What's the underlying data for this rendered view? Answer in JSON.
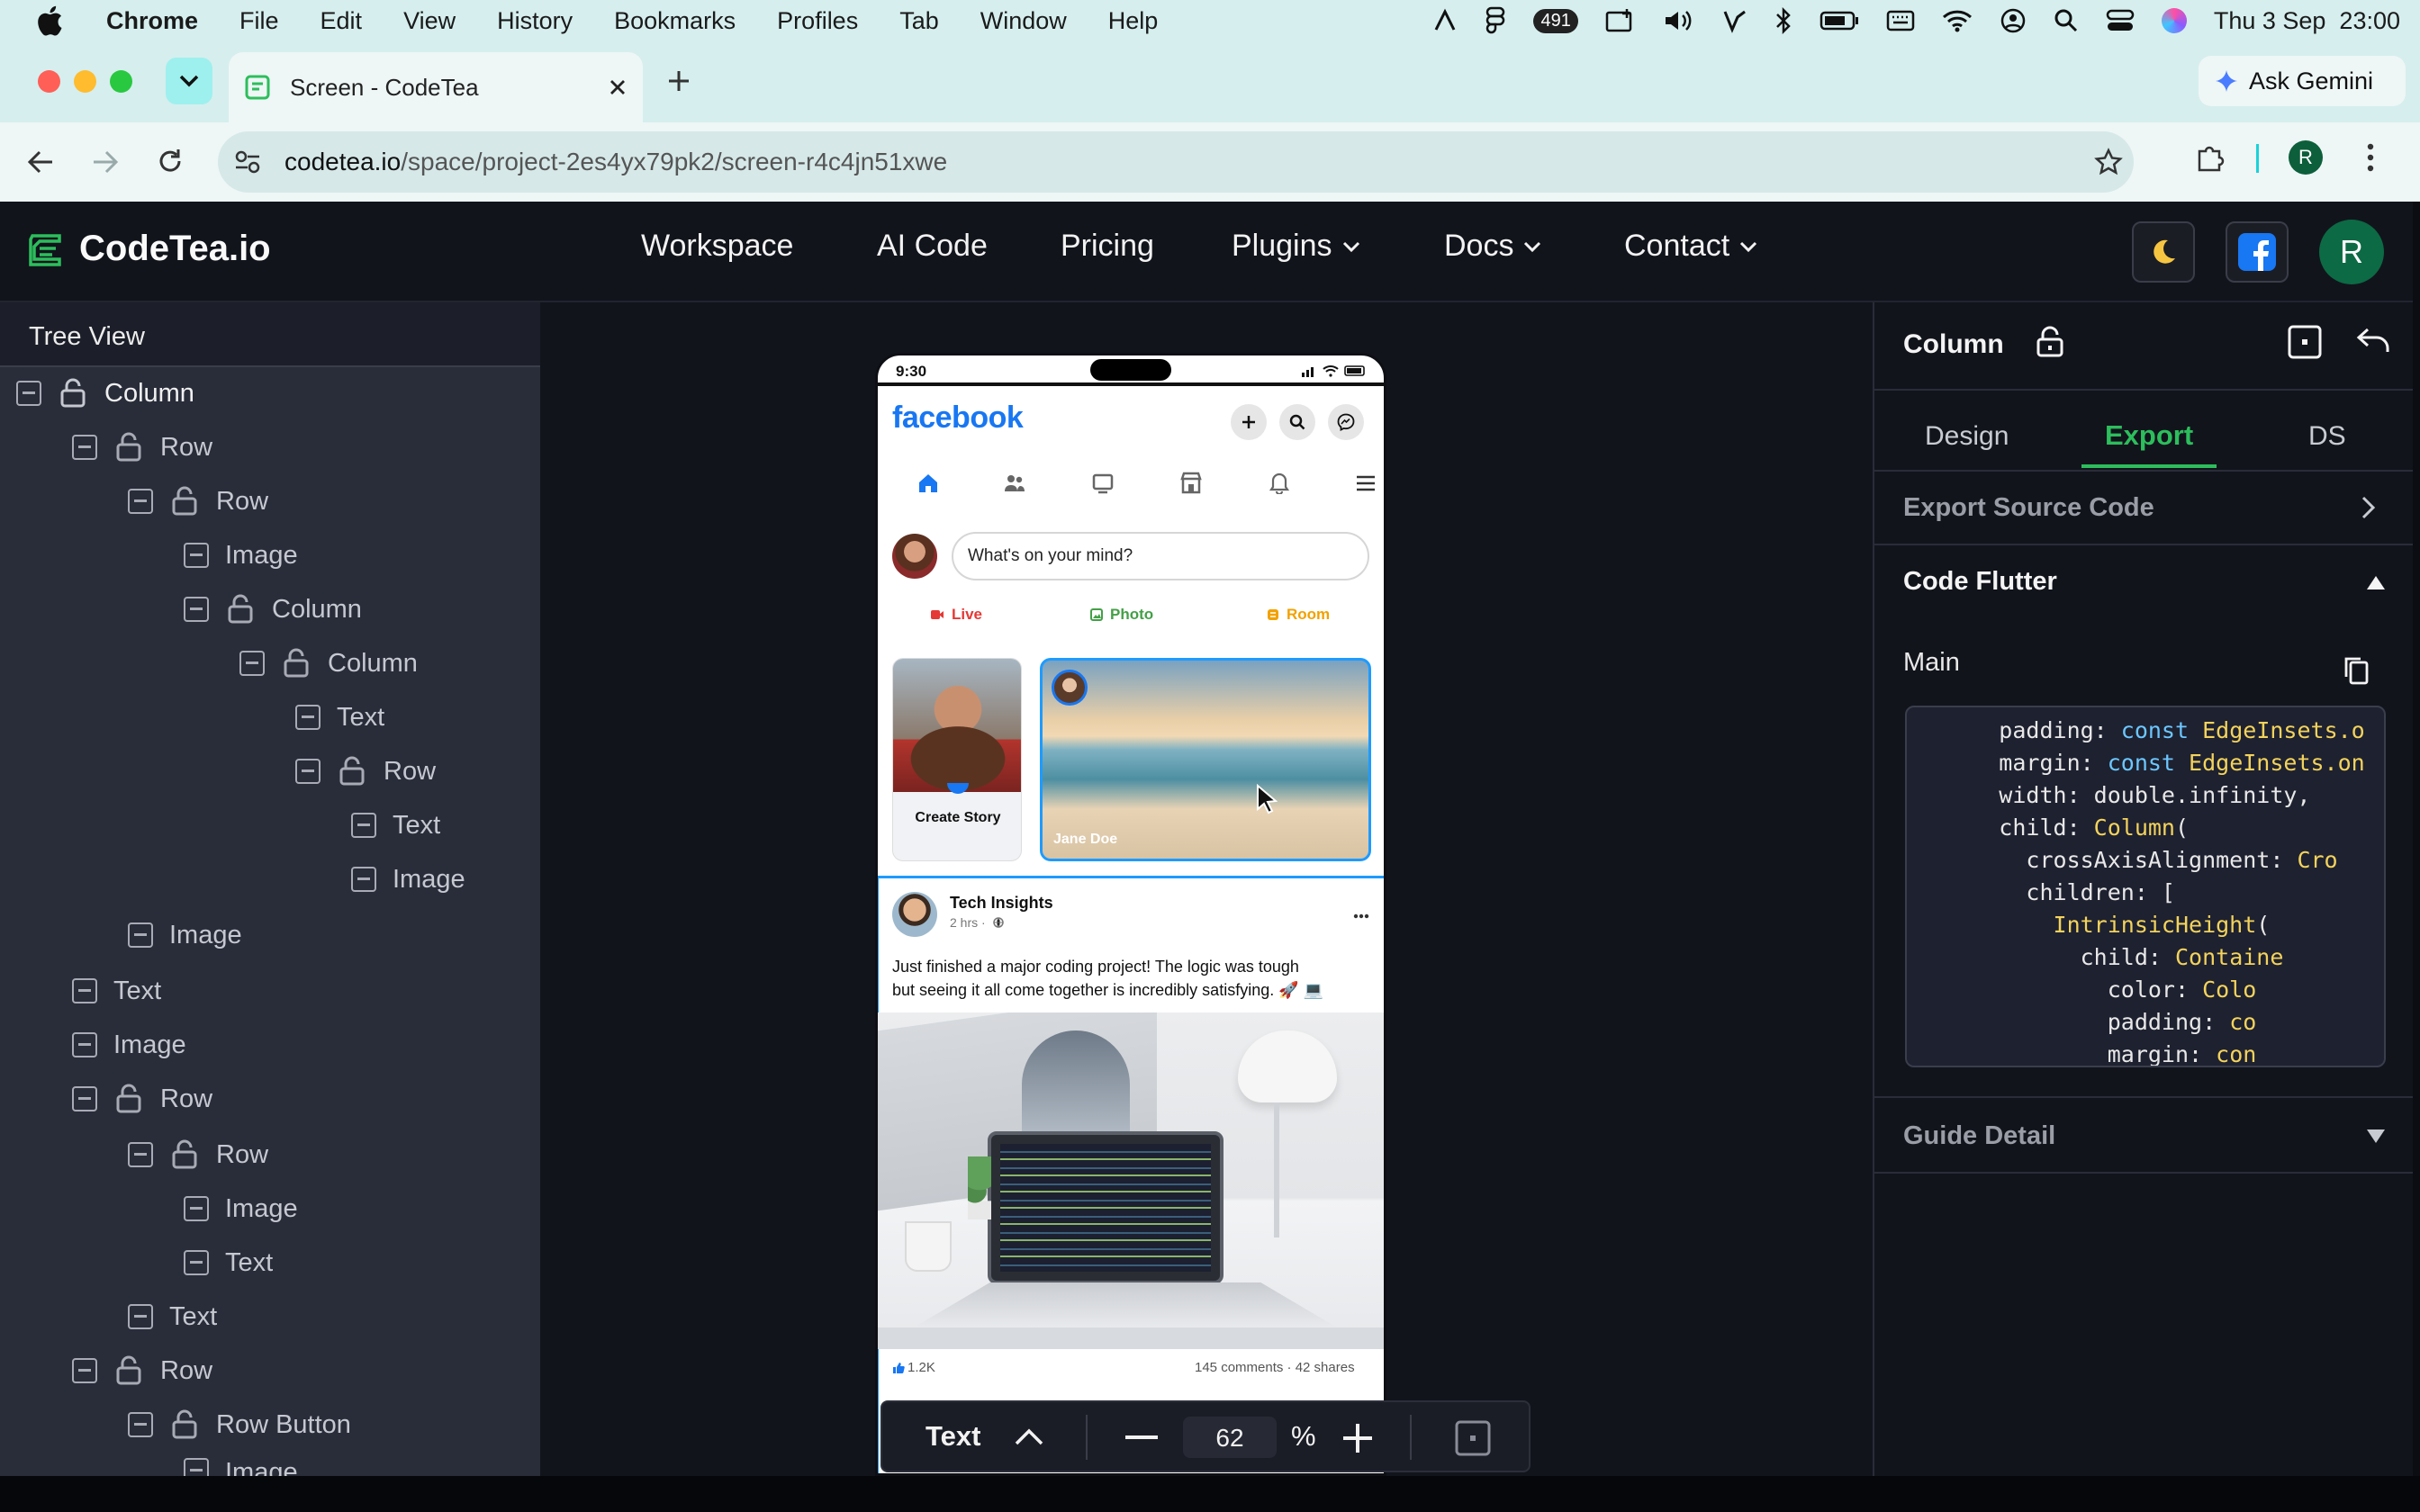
{
  "menubar": {
    "app": "Chrome",
    "items": [
      "File",
      "Edit",
      "View",
      "History",
      "Bookmarks",
      "Profiles",
      "Tab",
      "Window",
      "Help"
    ],
    "badge": "491",
    "datetime": "Thu 3 Sep  23:00"
  },
  "browser": {
    "tab_title": "Screen - CodeTea",
    "url_domain": "codetea.io",
    "url_path": "/space/project-2es4yx79pk2/screen-r4c4jn51xwe",
    "gemini": "Ask Gemini",
    "profile_initial": "R"
  },
  "app": {
    "logo": "CodeTea.io",
    "nav": [
      {
        "label": "Workspace"
      },
      {
        "label": "AI Code"
      },
      {
        "label": "Pricing"
      },
      {
        "label": "Plugins"
      },
      {
        "label": "Docs"
      },
      {
        "label": "Contact"
      }
    ],
    "avatar_initial": "R"
  },
  "tree": {
    "title": "Tree View",
    "items": [
      {
        "label": "Column",
        "lock": true
      },
      {
        "label": "Row",
        "lock": true
      },
      {
        "label": "Row",
        "lock": true
      },
      {
        "label": "Image",
        "lock": false
      },
      {
        "label": "Column",
        "lock": true
      },
      {
        "label": "Column",
        "lock": true
      },
      {
        "label": "Text",
        "lock": false
      },
      {
        "label": "Row",
        "lock": true
      },
      {
        "label": "Text",
        "lock": false
      },
      {
        "label": "Image",
        "lock": false
      },
      {
        "label": "Image",
        "lock": false
      },
      {
        "label": "Text",
        "lock": false
      },
      {
        "label": "Image",
        "lock": false
      },
      {
        "label": "Row",
        "lock": true
      },
      {
        "label": "Row",
        "lock": true
      },
      {
        "label": "Image",
        "lock": false
      },
      {
        "label": "Text",
        "lock": false
      },
      {
        "label": "Text",
        "lock": false
      },
      {
        "label": "Row",
        "lock": true
      },
      {
        "label": "Row Button",
        "lock": true
      },
      {
        "label": "Image",
        "lock": false
      }
    ]
  },
  "phone": {
    "time": "9:30",
    "brand": "facebook",
    "composer_placeholder": "What's on your mind?",
    "actions": [
      {
        "label": "Live",
        "color": "#e53935"
      },
      {
        "label": "Photo",
        "color": "#43a047"
      },
      {
        "label": "Room",
        "color": "#f2a100"
      }
    ],
    "story_create": "Create Story",
    "story_name": "Jane Doe",
    "post": {
      "author": "Tech Insights",
      "meta": "2 hrs · ",
      "text_line1": "Just finished a major coding project! The logic was tough",
      "text_line2": "but seeing it all come together is incredibly satisfying. 🚀 💻",
      "likes": "1.2K",
      "stats": "145 comments · 42 shares"
    }
  },
  "panel": {
    "title": "Column",
    "tabs": [
      "Design",
      "Export",
      "DS"
    ],
    "active_tab": "Export",
    "export_source": "Export Source Code",
    "code_flutter": "Code Flutter",
    "main_label": "Main",
    "guide": "Guide Detail",
    "code_lines": [
      "      padding: const EdgeInsets.o",
      "      margin: const EdgeInsets.on",
      "      width: double.infinity,",
      "      child: Column(",
      "        crossAxisAlignment: Cro",
      "        children: [",
      "          IntrinsicHeight(",
      "            child: Containe",
      "              color: Colo",
      "              padding: co",
      "              margin: con"
    ]
  },
  "zoom": {
    "element": "Text",
    "value": "62",
    "unit": "%"
  },
  "colors": {
    "accent_green": "#2dbe5c",
    "facebook_blue": "#1877f2",
    "selection_blue": "#1e9bff"
  }
}
